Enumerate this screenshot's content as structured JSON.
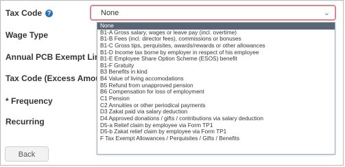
{
  "form": {
    "labels": {
      "tax_code": "Tax Code",
      "wage_type": "Wage Type",
      "pcb_exempt": "Annual PCB Exempt Limit",
      "tax_code_excess": "Tax Code (Excess Amount)",
      "frequency": "* Frequency",
      "recurring": "Recurring"
    },
    "help_icon_glyph": "?",
    "back_button": "Back"
  },
  "select": {
    "value": "None",
    "chevron_glyph": "⌄"
  },
  "dropdown": {
    "options": [
      "None",
      "B1-A  Gross salary, wages or leave pay (incl. overtime)",
      "B1-B  Fees (incl. director fees), commissions or bonuses",
      "B1-C  Gross tips, perquisites, awards/rewards or other allowances",
      "B1-D  Income tax borne by employer in respect of his employee",
      "B1-E  Employee Share Option Scheme (ESOS) benefit",
      "B1-F  Gratuity",
      "B3     Benefits in kind",
      "B4     Value of living accomodations",
      "B5     Refund from unapproved pension",
      "B6     Compensation for loss of employment",
      "C1     Pension",
      "C2     Annuities or other periodical payments",
      "D3     Zakat paid via salary deduction",
      "D4     Approved donations / gifts / contributions via salary deduction",
      "D5-a  Relief claim by employee via Form TP1",
      "D5-b  Zakat relief claim by employee via Form TP1",
      "F      Tax Exempt Allowances / Perquisites / Gifts / Benefits"
    ],
    "selected_index": 0
  },
  "colors": {
    "select_border": "#d9868c",
    "selected_option_bg": "#5a6675",
    "help_icon": "#2c6fb5"
  }
}
